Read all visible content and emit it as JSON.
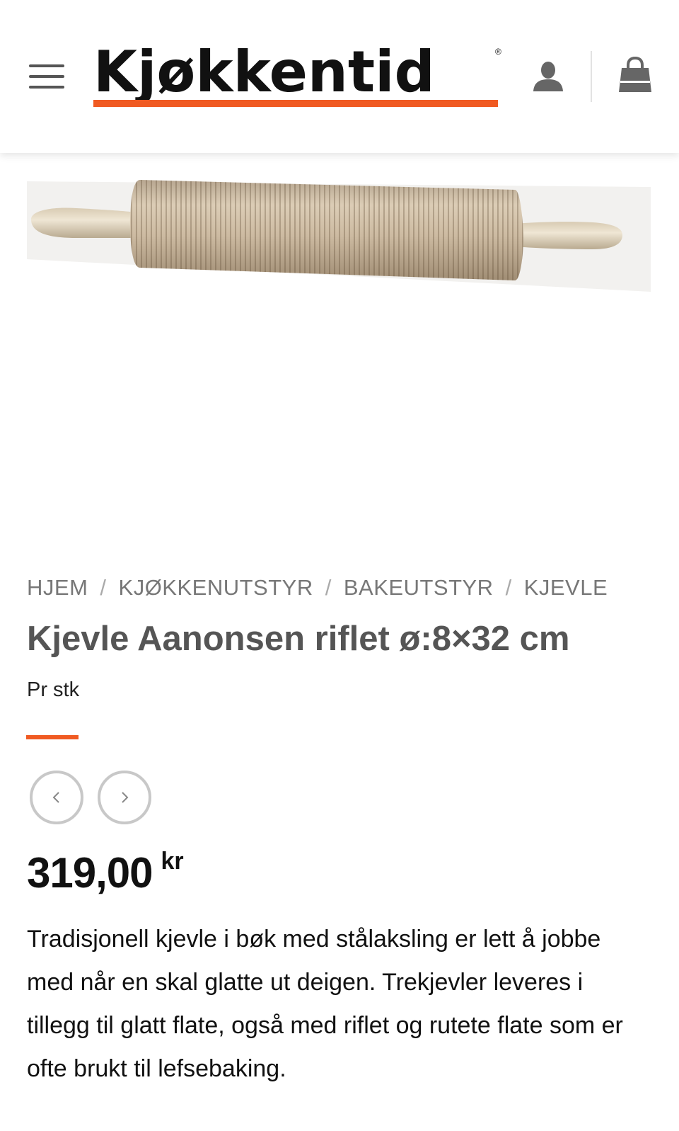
{
  "header": {
    "logo_text": "Kjøkkentid",
    "logo_reg": "®",
    "menu_icon": "hamburger-menu-icon",
    "account_icon": "user-icon",
    "cart_icon": "shopping-bag-icon",
    "brand_color": "#f05a22"
  },
  "product": {
    "image_icon": "rolling-pin-image",
    "breadcrumb": [
      "HJEM",
      "KJØKKENUTSTYR",
      "BAKEUTSTYR",
      "KJEVLE"
    ],
    "breadcrumb_separator": "/",
    "title": "Kjevle Aanonsen riflet ø:8×32 cm",
    "unit": "Pr stk",
    "price": "319,00",
    "currency": "kr",
    "description": "Tradisjonell kjevle i bøk med stålaksling er lett å jobbe med når en skal glatte ut deigen. Trekjevler leveres i tillegg til glatt flate, også med riflet og rutete flate som er ofte brukt til lefsebaking.",
    "prev_icon": "chevron-left-icon",
    "next_icon": "chevron-right-icon"
  }
}
